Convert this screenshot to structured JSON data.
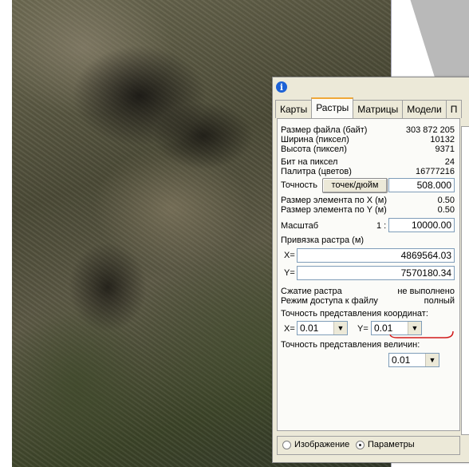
{
  "dialog": {
    "tabs": [
      "Карты",
      "Растры",
      "Матрицы",
      "Модели",
      "П"
    ],
    "active_tab": 1,
    "info": [
      {
        "label": "Размер файла (байт)",
        "value": "303 872 205"
      },
      {
        "label": "Ширина (пиксел)",
        "value": "10132"
      },
      {
        "label": "Высота (пиксел)",
        "value": "9371"
      },
      {
        "label": "Бит на пиксел",
        "value": "24"
      },
      {
        "label": "Палитра (цветов)",
        "value": "16777216"
      }
    ],
    "precision_label": "Точность",
    "precision_unit_button": "точек/дюйм",
    "precision_value": "508.000",
    "element_size": [
      {
        "label": "Размер элемента по X (м)",
        "value": "0.50"
      },
      {
        "label": "Размер элемента по Y (м)",
        "value": "0.50"
      }
    ],
    "scale_label": "Масштаб",
    "scale_prefix": "1 :",
    "scale_value": "10000.00",
    "binding_label": "Привязка растра (м)",
    "x_label": "X=",
    "x_value": "4869564.03",
    "y_label": "Y=",
    "y_value": "7570180.34",
    "compression_label": "Сжатие растра",
    "compression_value": "не выполнено",
    "access_label": "Режим доступа к файлу",
    "access_value": "полный",
    "coord_precision_label": "Точность представления координат:",
    "coord_x_label": "X=",
    "coord_x_value": "0.01",
    "coord_y_label": "Y=",
    "coord_y_value": "0.01",
    "value_precision_label": "Точность представления величин:",
    "value_precision_value": "0.01",
    "radio_image": "Изображение",
    "radio_params": "Параметры",
    "radio_selected": "Параметры"
  },
  "colors": {
    "accent_tab": "#f0a838",
    "info_icon": "#1d62d6",
    "annotation": "#d11a1a"
  }
}
